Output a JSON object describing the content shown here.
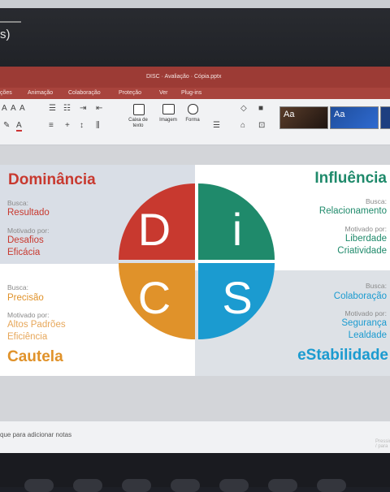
{
  "os_fragment": "s)",
  "window": {
    "title": "DISC · Avaliação · Cópia.pptx"
  },
  "menu": [
    "ções",
    "Animação",
    "Colaboração",
    "Proteção",
    "Ver",
    "Plug-ins"
  ],
  "ribbon": {
    "text_box_label": "Caixa de texto",
    "image_label": "Imagem",
    "shape_label": "Forma",
    "style_glyph": "Aa"
  },
  "disc": {
    "d": {
      "title": "Dominância",
      "letter": "D",
      "color": "#c8392f",
      "seek_label": "Busca:",
      "seek": "Resultado",
      "motivated_label": "Motivado por:",
      "motivators": [
        "Desafios",
        "Eficácia"
      ]
    },
    "i": {
      "title": "Influência",
      "letter": "i",
      "color": "#1f8a6b",
      "seek_label": "Busca:",
      "seek": "Relacionamento",
      "motivated_label": "Motivado por:",
      "motivators": [
        "Liberdade",
        "Criatividade"
      ]
    },
    "c": {
      "title": "Cautela",
      "letter": "C",
      "color": "#e0922a",
      "seek_label": "Busca:",
      "seek": "Precisão",
      "motivated_label": "Motivado por:",
      "motivators": [
        "Altos Padrões",
        "Eficiência"
      ]
    },
    "s": {
      "title": "eStabilidade",
      "letter": "S",
      "color": "#1b9bd0",
      "seek_label": "Busca:",
      "seek": "Colaboração",
      "motivated_label": "Motivado por:",
      "motivators": [
        "Segurança",
        "Lealdade"
      ]
    }
  },
  "notes_placeholder": "que para adicionar notas",
  "status_hint": "Pressione / para"
}
